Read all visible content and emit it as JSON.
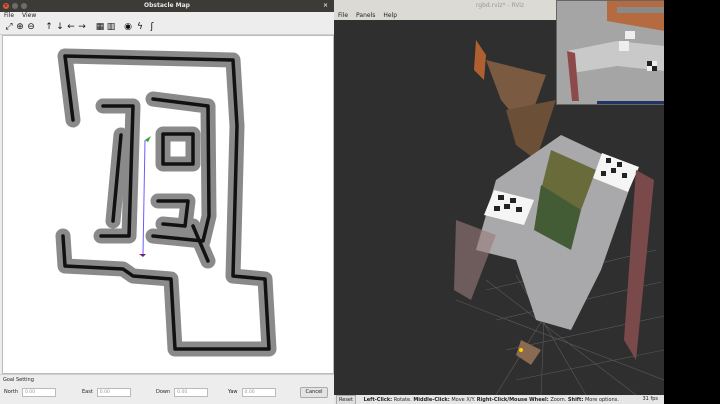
{
  "map_window": {
    "title": "Obstacle Map",
    "menu": [
      "File",
      "View"
    ],
    "toolbar_icons": [
      "fit-icon",
      "zoom-in-icon",
      "zoom-out-icon",
      "arrow-up-icon",
      "arrow-down-icon",
      "arrow-left-icon",
      "arrow-right-icon",
      "grid-icon",
      "grid2-icon",
      "target-icon",
      "waypoint-icon",
      "path-icon"
    ],
    "goal_setting": {
      "title": "Goal Setting",
      "fields": [
        {
          "label": "North",
          "value": "0.00"
        },
        {
          "label": "East",
          "value": "0.00"
        },
        {
          "label": "Down",
          "value": "0.00"
        },
        {
          "label": "Yaw",
          "value": "0.00"
        }
      ],
      "cancel_label": "Cancel"
    }
  },
  "rviz_window": {
    "title": "rgbd.rviz* - RViz",
    "menu": [
      "File",
      "Panels",
      "Help"
    ],
    "status": {
      "reset_label": "Reset",
      "left_click_key": "Left-Click:",
      "left_click_action": "Rotate.",
      "middle_click_key": "Middle-Click:",
      "middle_click_action": "Move X/Y.",
      "right_click_key": "Right-Click/Mouse Wheel:",
      "right_click_action": "Zoom.",
      "shift_key": "Shift:",
      "shift_action": "More options."
    },
    "fps": "31 fps"
  },
  "colors": {
    "titlebar_dark": "#3c3b37",
    "wall": "#111111",
    "inflation": "#8a8a8a",
    "rviz_bg": "#2f2f2f"
  }
}
